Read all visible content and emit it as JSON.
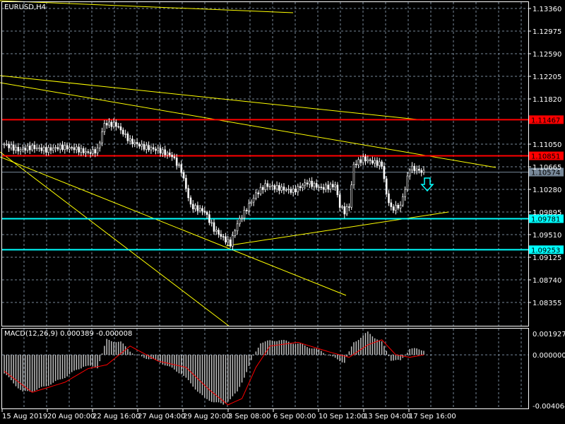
{
  "chart": {
    "title": "EURUSD,H4",
    "symbol": "EURUSD",
    "timeframe": "H4",
    "price_axis": [
      "1.13360",
      "1.12975",
      "1.12590",
      "1.12205",
      "1.11820",
      "1.11050",
      "1.10665",
      "1.10280",
      "1.09895",
      "1.09510",
      "1.09125",
      "1.08740",
      "1.08355"
    ],
    "price_range": [
      1.079,
      1.138
    ],
    "levels": [
      {
        "price": 1.11467,
        "label": "1.11467",
        "color": "#ff0000",
        "text_color": "#000000"
      },
      {
        "price": 1.10851,
        "label": "1.10851",
        "color": "#ff0000",
        "text_color": "#000000"
      },
      {
        "price": 1.10574,
        "label": "1.10574",
        "color": "#778899",
        "text_color": "#000000"
      },
      {
        "price": 1.09781,
        "label": "1.09781",
        "color": "#00ffff",
        "text_color": "#000000"
      },
      {
        "price": 1.09253,
        "label": "1.09253",
        "color": "#00ffff",
        "text_color": "#000000"
      }
    ],
    "price_path": [
      [
        0,
        1.1105
      ],
      [
        6,
        1.1095
      ],
      [
        12,
        1.11
      ],
      [
        18,
        1.1095
      ],
      [
        24,
        1.11
      ],
      [
        30,
        1.1098
      ],
      [
        36,
        1.109
      ],
      [
        40,
        1.1095
      ],
      [
        43,
        1.114
      ],
      [
        48,
        1.1138
      ],
      [
        54,
        1.111
      ],
      [
        60,
        1.11
      ],
      [
        66,
        1.1095
      ],
      [
        72,
        1.1085
      ],
      [
        76,
        1.106
      ],
      [
        80,
        1.1
      ],
      [
        86,
        1.099
      ],
      [
        90,
        1.096
      ],
      [
        94,
        1.0945
      ],
      [
        97,
        1.0935
      ],
      [
        100,
        1.097
      ],
      [
        104,
        1.0995
      ],
      [
        108,
        1.102
      ],
      [
        112,
        1.1035
      ],
      [
        118,
        1.103
      ],
      [
        124,
        1.1025
      ],
      [
        130,
        1.104
      ],
      [
        136,
        1.103
      ],
      [
        142,
        1.1035
      ],
      [
        144,
        1.1
      ],
      [
        146,
        1.099
      ],
      [
        148,
        1.1
      ],
      [
        150,
        1.107
      ],
      [
        154,
        1.108
      ],
      [
        158,
        1.1075
      ],
      [
        162,
        1.107
      ],
      [
        164,
        1.102
      ],
      [
        166,
        1.0995
      ],
      [
        170,
        1.1
      ],
      [
        172,
        1.103
      ],
      [
        174,
        1.1065
      ],
      [
        178,
        1.106
      ],
      [
        180,
        1.10574
      ]
    ],
    "bar_count": 181,
    "colors": {
      "candle_up": "#ffffff",
      "candle_down": "#ffffff",
      "bar_body_down": "#000000",
      "trendline": "#ffff00",
      "grid": "#778899",
      "arrow": "#00ffff"
    },
    "arrow_signal": "down-arrow"
  },
  "macd": {
    "label": "MACD(12,26,9) 0.000389 -0.000008",
    "axis": [
      "0.001927",
      "0.000000",
      "-0.004064"
    ],
    "range": [
      -0.004064,
      0.001927
    ],
    "hist_path": [
      [
        0,
        -0.0015
      ],
      [
        8,
        -0.003
      ],
      [
        14,
        -0.0028
      ],
      [
        24,
        -0.002
      ],
      [
        34,
        -0.0009
      ],
      [
        40,
        -0.001
      ],
      [
        44,
        0.0012
      ],
      [
        50,
        0.001
      ],
      [
        56,
        0.0
      ],
      [
        66,
        -0.0005
      ],
      [
        76,
        -0.0015
      ],
      [
        86,
        -0.0035
      ],
      [
        94,
        -0.004
      ],
      [
        100,
        -0.003
      ],
      [
        106,
        -0.0005
      ],
      [
        110,
        0.001
      ],
      [
        118,
        0.0012
      ],
      [
        128,
        0.0008
      ],
      [
        136,
        0.0003
      ],
      [
        142,
        -0.0003
      ],
      [
        146,
        -0.0006
      ],
      [
        150,
        0.001
      ],
      [
        156,
        0.0018
      ],
      [
        162,
        0.001
      ],
      [
        166,
        -0.0004
      ],
      [
        170,
        -0.0005
      ],
      [
        174,
        0.0005
      ],
      [
        180,
        0.0004
      ]
    ],
    "signal_path": [
      [
        0,
        -0.0013
      ],
      [
        12,
        -0.003
      ],
      [
        26,
        -0.0022
      ],
      [
        36,
        -0.0011
      ],
      [
        44,
        -0.0008
      ],
      [
        54,
        0.0007
      ],
      [
        66,
        -0.0005
      ],
      [
        78,
        -0.001
      ],
      [
        88,
        -0.0028
      ],
      [
        96,
        -0.004
      ],
      [
        102,
        -0.0035
      ],
      [
        108,
        -0.001
      ],
      [
        114,
        0.0007
      ],
      [
        126,
        0.001
      ],
      [
        140,
        0.0002
      ],
      [
        148,
        -0.0002
      ],
      [
        156,
        0.0008
      ],
      [
        162,
        0.0012
      ],
      [
        168,
        0.0
      ],
      [
        174,
        -0.0002
      ],
      [
        180,
        0.0
      ]
    ],
    "colors": {
      "histogram": "#c0c0c0",
      "signal": "#ff0000"
    }
  },
  "time_axis": [
    "15 Aug 2019",
    "20 Aug 00:00",
    "22 Aug 16:00",
    "27 Aug 04:00",
    "29 Aug 20:00",
    "3 Sep 08:00",
    "6 Sep 00:00",
    "10 Sep 12:00",
    "13 Sep 04:00",
    "17 Sep 16:00"
  ]
}
